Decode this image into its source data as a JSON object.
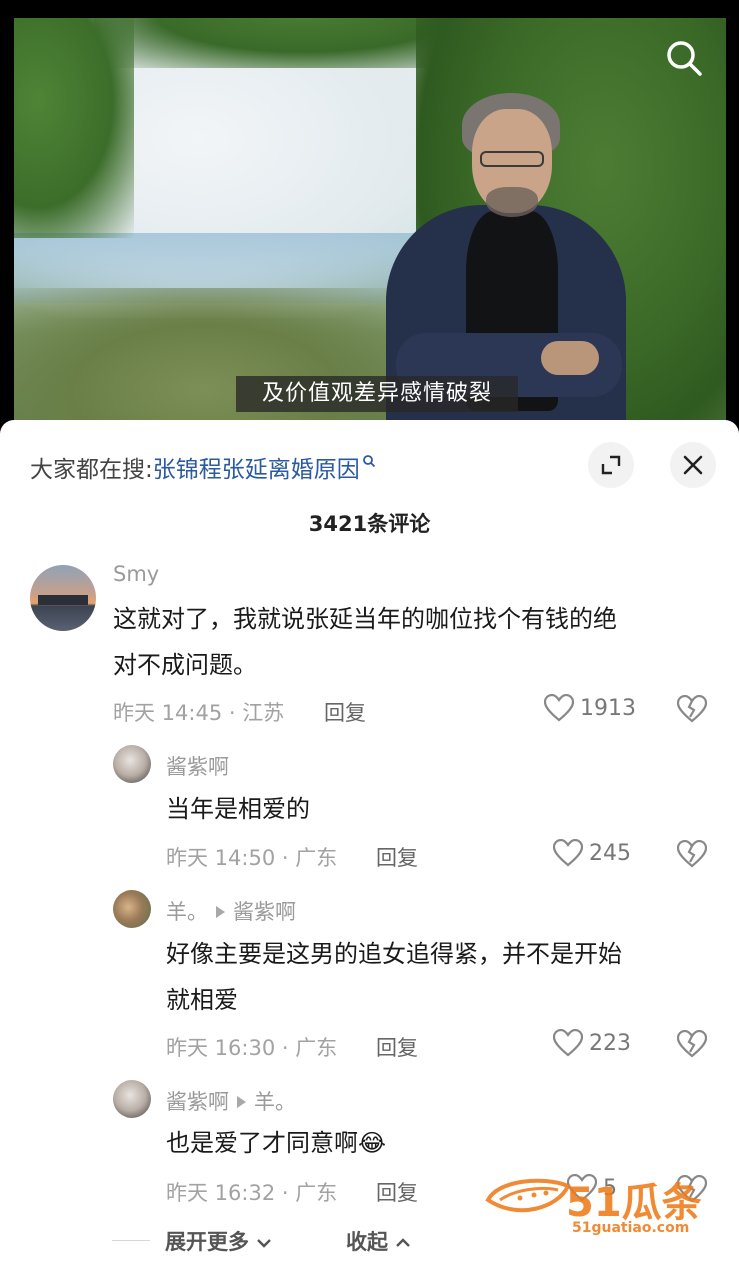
{
  "video": {
    "subtitle": "及价值观差异感情破裂"
  },
  "hot_search": {
    "prefix": "大家都在搜:",
    "keyword": "张锦程张延离婚原因"
  },
  "comment_count": "3421条评论",
  "comments": [
    {
      "author": "Smy",
      "text_line1": "这就对了，我就说张延当年的咖位找个有钱的绝",
      "text_line2": "对不成问题。",
      "meta": "昨天 14:45 · 江苏",
      "reply": "回复",
      "likes": "1913"
    },
    {
      "author": "酱紫啊",
      "text": "当年是相爱的",
      "meta": "昨天 14:50 · 广东",
      "reply": "回复",
      "likes": "245"
    },
    {
      "author": "羊。",
      "reply_to": "酱紫啊",
      "text_line1": "好像主要是这男的追女追得紧，并不是开始",
      "text_line2": "就相爱",
      "meta": "昨天 16:30 · 广东",
      "reply": "回复",
      "likes": "223"
    },
    {
      "author": "酱紫啊",
      "reply_to": "羊。",
      "text": "也是爱了才同意啊",
      "emoji": "😂",
      "meta": "昨天 16:32 · 广东",
      "reply": "回复",
      "likes": "5"
    }
  ],
  "footer": {
    "expand_more": "展开更多",
    "collapse": "收起"
  },
  "watermark": {
    "brand": "51瓜条",
    "domain": "51guatiao.com"
  },
  "colors": {
    "keyword_blue": "#2b5aa0",
    "watermark_orange": "#f07a1a"
  },
  "icons": [
    "search-icon",
    "expand-icon",
    "close-icon",
    "heart-icon",
    "broken-heart-icon",
    "chevron-down-icon",
    "chevron-up-icon"
  ]
}
